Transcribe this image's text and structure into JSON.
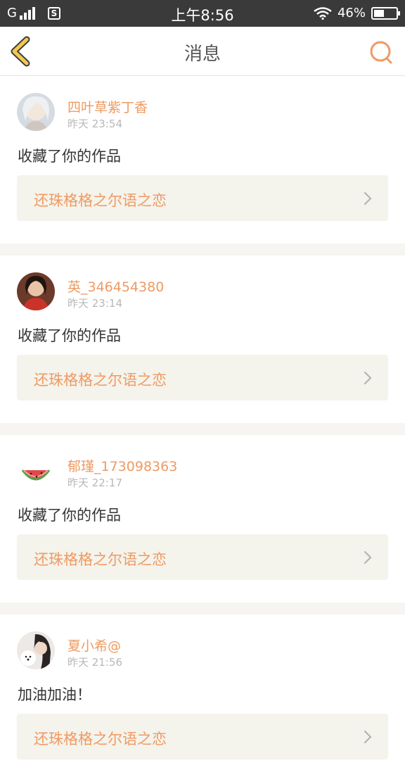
{
  "status_bar": {
    "carrier": "G",
    "time": "上午8:56",
    "battery": "46%",
    "battery_level": 0.46
  },
  "nav": {
    "title": "消息",
    "back_icon": "chevron-left-icon",
    "search_icon": "search-icon"
  },
  "colors": {
    "accent": "#ef9a62",
    "back_icon": "#e8c24a",
    "card_bg": "#f4f3ec",
    "separator": "#f7f5f1"
  },
  "messages": [
    {
      "user": "四叶草紫丁香",
      "time": "昨天 23:54",
      "text": "收藏了你的作品",
      "work": "还珠格格之尔语之恋"
    },
    {
      "user": "英_346454380",
      "time": "昨天 23:14",
      "text": "收藏了你的作品",
      "work": "还珠格格之尔语之恋"
    },
    {
      "user": "郁瑾_173098363",
      "time": "昨天 22:17",
      "text": "收藏了你的作品",
      "work": "还珠格格之尔语之恋"
    },
    {
      "user": "夏小希@",
      "time": "昨天 21:56",
      "text": "加油加油！",
      "work": "还珠格格之尔语之恋"
    }
  ]
}
